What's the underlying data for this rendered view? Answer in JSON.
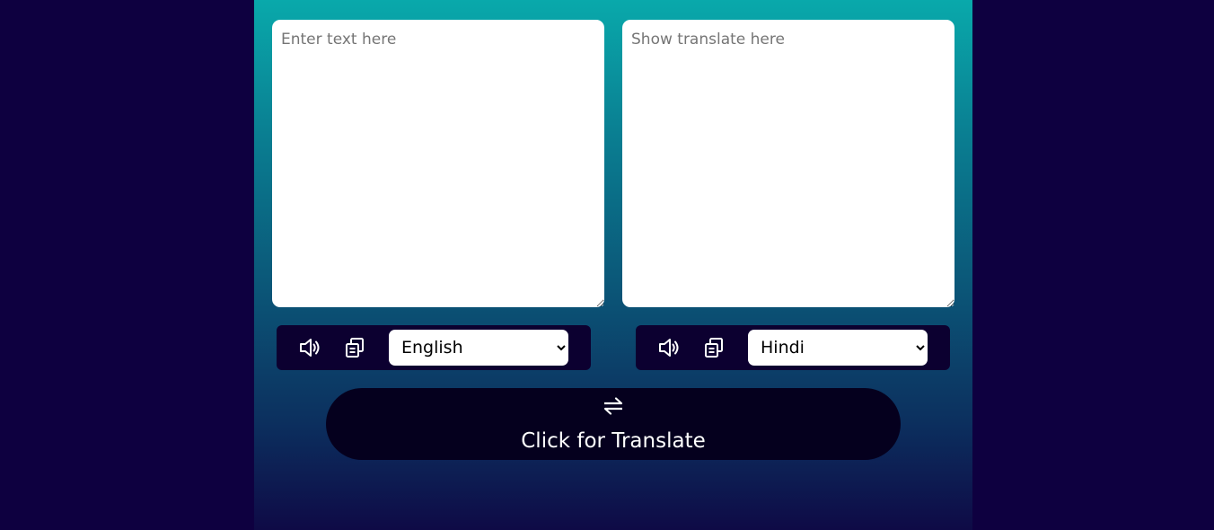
{
  "source": {
    "placeholder": "Enter text here",
    "language": "English",
    "speak_icon": "volume-icon",
    "copy_icon": "copy-icon"
  },
  "target": {
    "placeholder": "Show translate here",
    "language": "Hindi",
    "speak_icon": "volume-icon",
    "copy_icon": "copy-icon"
  },
  "translate_button": {
    "icon": "exchange-icon",
    "label": "Click for Translate"
  },
  "colors": {
    "page_background": "#0e0040",
    "gradient_top": "#09a9ab",
    "gradient_bottom": "#0e0a46",
    "control_bar": "#0c0030",
    "button": "#05001e"
  }
}
